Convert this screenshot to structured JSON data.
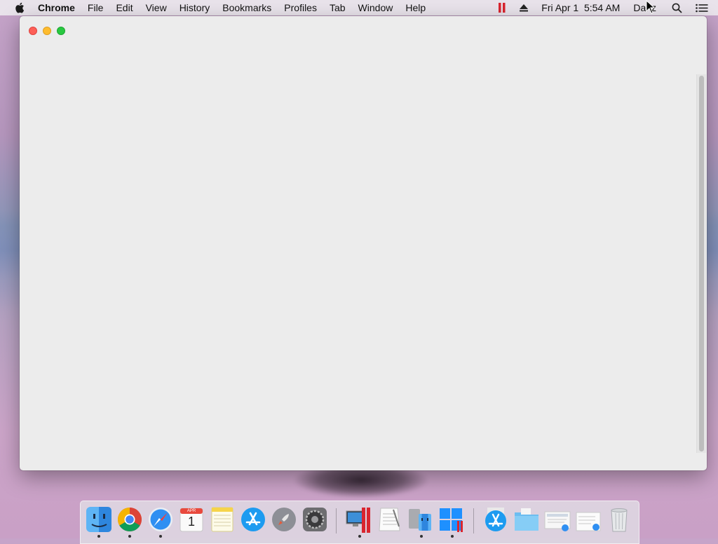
{
  "menubar": {
    "app_name": "Chrome",
    "items": [
      "File",
      "Edit",
      "View",
      "History",
      "Bookmarks",
      "Profiles",
      "Tab",
      "Window",
      "Help"
    ],
    "status": {
      "datetime": "Fri Apr 1  5:54 AM",
      "user": "Dariz"
    },
    "icons": {
      "apple": "apple-logo-icon",
      "parallels": "parallels-icon",
      "eject": "eject-icon",
      "search": "spotlight-search-icon",
      "notifications": "notification-center-icon"
    }
  },
  "window": {
    "background_color": "#ececec"
  },
  "dock": {
    "calendar": {
      "month": "APR",
      "day": "1"
    },
    "apps": [
      "finder-icon",
      "chrome-icon",
      "safari-icon",
      "calendar-icon",
      "notes-icon",
      "app-store-icon",
      "launchpad-icon",
      "system-preferences-icon",
      "parallels-vm-icon",
      "textedit-icon",
      "migration-assistant-icon",
      "windows-app-icon",
      "downloads-stack-icon",
      "folder-icon",
      "screenshot-stack-icon",
      "documents-stack-icon",
      "trash-icon"
    ]
  },
  "colors": {
    "close": "#fd5f57",
    "minimize": "#febc2e",
    "maximize": "#28c840",
    "parallels_red": "#d9252f"
  }
}
